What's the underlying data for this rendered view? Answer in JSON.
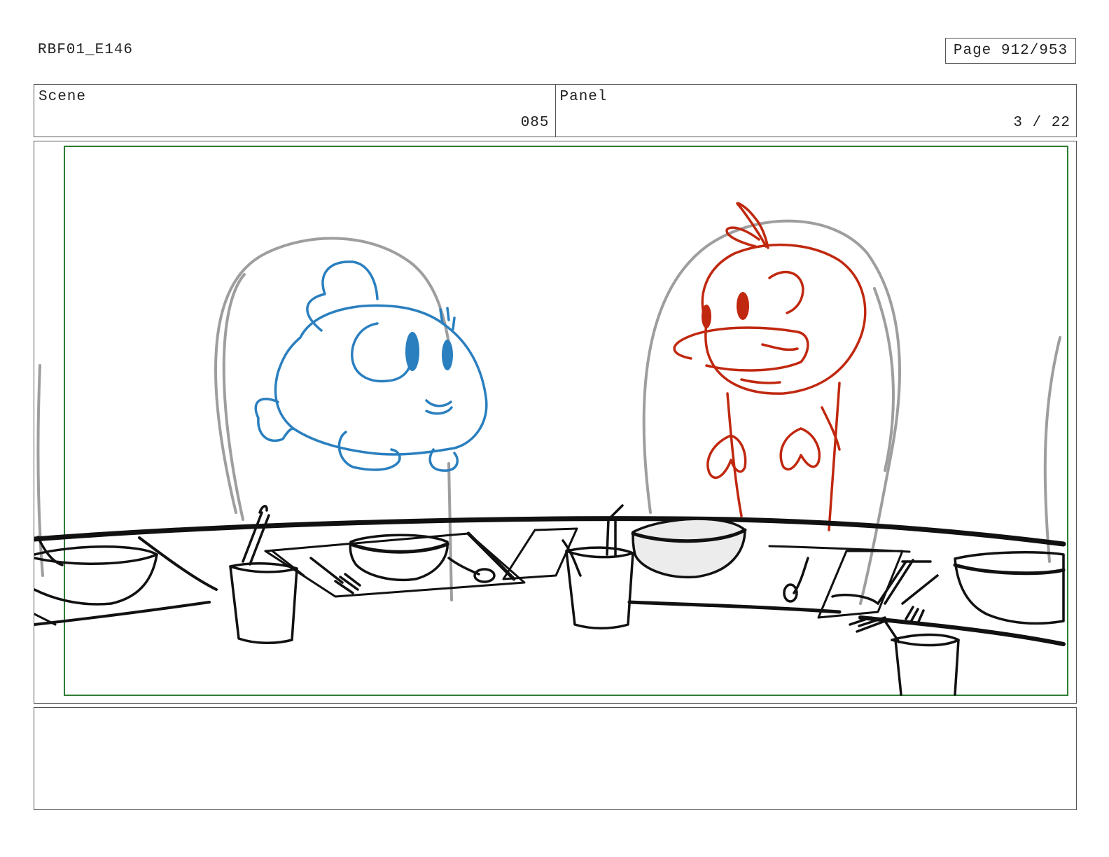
{
  "header": {
    "document_id": "RBF01_E146",
    "page_label": "Page 912/953"
  },
  "scene": {
    "label": "Scene",
    "value": "085"
  },
  "panel": {
    "label": "Panel",
    "value": "3 / 22"
  },
  "drawing": {
    "colors": {
      "safe_frame": "#2e7d32",
      "left_character": "#2a7fbf",
      "right_character": "#c0280f",
      "chairs": "#9e9e9e",
      "ink": "#111111"
    },
    "content": [
      "blue-fish-character",
      "red-bird-character",
      "two-chairs",
      "table-with-bowls-cups-and-utensils"
    ]
  },
  "notes": {
    "text": ""
  }
}
